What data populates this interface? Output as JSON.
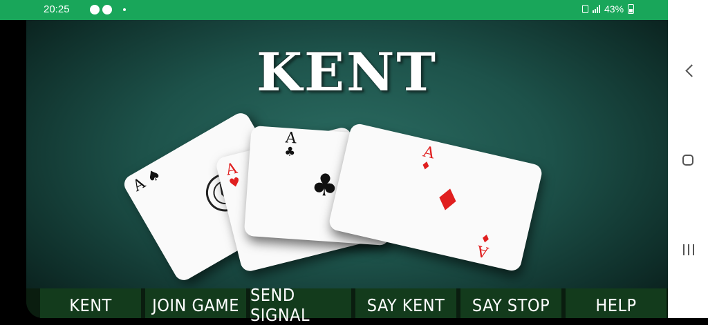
{
  "status_bar": {
    "time": "20:25",
    "battery": "43%"
  },
  "title": "KENT",
  "cards": [
    {
      "rank": "A",
      "suit": "♠",
      "color": "black",
      "name": "ace-of-spades"
    },
    {
      "rank": "A",
      "suit": "♥",
      "color": "red",
      "name": "ace-of-hearts"
    },
    {
      "rank": "A",
      "suit": "♣",
      "color": "black",
      "name": "ace-of-clubs"
    },
    {
      "rank": "A",
      "suit": "♦",
      "color": "red",
      "name": "ace-of-diamonds"
    }
  ],
  "menu": [
    "KENT",
    "JOIN GAME",
    "SEND SIGNAL",
    "SAY KENT",
    "SAY STOP",
    "HELP"
  ],
  "colors": {
    "status_bar": "#19a65a",
    "menu_button": "#133b1c",
    "felt": "#1d524a",
    "red_suit": "#e01f1f"
  }
}
